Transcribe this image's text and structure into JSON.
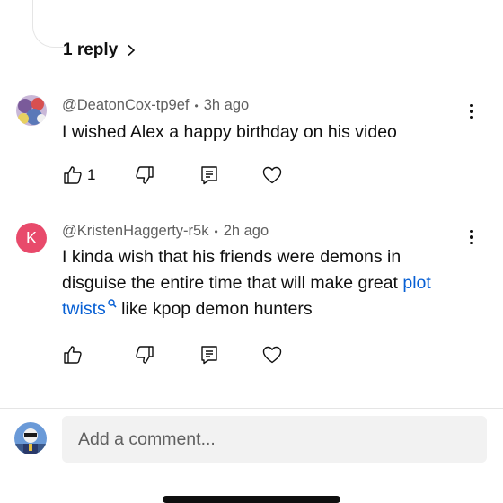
{
  "thread": {
    "replies_label": "1 reply"
  },
  "comments": [
    {
      "author": "@DeatonCox-tp9ef",
      "time": "3h ago",
      "text": "I wished Alex a happy birthday on his video",
      "likes": "1"
    },
    {
      "author": "@KristenHaggerty-r5k",
      "time": "2h ago",
      "avatar_letter": "K",
      "text_line1": "I kinda wish that his friends were demons in",
      "text_line2_before": "disguise the entire time that will make great ",
      "link_part1": "plot",
      "link_part2": "twists",
      "text_after_link": " like kpop demon hunters",
      "likes": ""
    }
  ],
  "composer": {
    "placeholder": "Add a comment..."
  },
  "colors": {
    "link": "#065fd4",
    "avatar_k": "#e84a6b",
    "meta": "#606060"
  },
  "icons": [
    "chevron-right-icon",
    "thumbs-up-icon",
    "thumbs-down-icon",
    "reply-icon",
    "heart-icon",
    "more-vert-icon",
    "search-icon"
  ]
}
